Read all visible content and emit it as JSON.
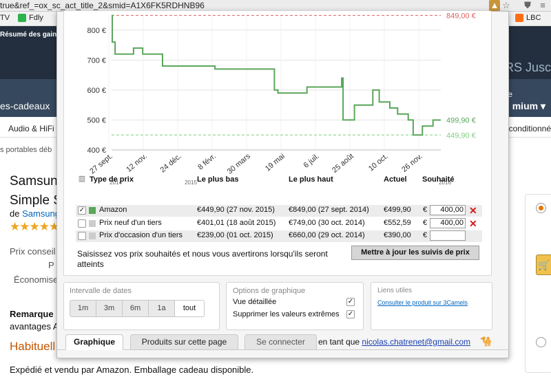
{
  "browser": {
    "url_fragment": "true&ref_=ox_sc_act_title_2&smid=A1X6FK5RDHNB96",
    "bookmarks": [
      "TV",
      "Fdly",
      "LBC"
    ]
  },
  "amazon": {
    "top_text": "Résumé des gains",
    "brand_right": "RS Jusc",
    "nav_left": "es-cadeaux",
    "nav_right": "mium ▾",
    "nav_right_small": "e",
    "category_left": "Audio & HiFi",
    "category_right": "conditionné",
    "breadcrumb": "s portables déb",
    "title_line1": "Samsung",
    "title_line2": "Simple S",
    "by_prefix": "de",
    "by_link": "Samsung",
    "stars": "★★★★★",
    "prix_conseille": "Prix conseil",
    "prix": "P",
    "economisez": "Économise",
    "remarque": "Remarque",
    "avantages": "avantages A",
    "habituel": "Habituell",
    "expedie": "Expédié et vendu par Amazon. Emballage cadeau disponible.",
    "cart_icon": "cart-icon"
  },
  "colors": {
    "amazon_series": "#5aa65a",
    "max_line": "#e06060",
    "min_line": "#7fcf7f",
    "link": "#0066c0"
  },
  "chart_data": {
    "type": "line",
    "ylabels": [
      "800 €",
      "700 €",
      "600 €",
      "500 €",
      "400 €"
    ],
    "ylim": [
      400,
      850
    ],
    "grid": true,
    "xlabels": [
      "27 sept.",
      "12 nov.",
      "24 déc.",
      "8 févr.",
      "30 mars",
      "19 mai",
      "6 juil.",
      "25 août",
      "10 oct.",
      "26 nov."
    ],
    "year_labels": [
      "2014",
      "2015",
      "2016"
    ],
    "reference_lines": [
      {
        "label": "849,00 €",
        "value": 849.0,
        "color": "#e06060"
      },
      {
        "label": "449,90 €",
        "value": 449.9,
        "color": "#7fcf7f"
      }
    ],
    "current_label": {
      "label": "499,90 €",
      "value": 499.9
    },
    "series": [
      {
        "name": "Amazon",
        "points": [
          [
            "2014-09-27",
            849
          ],
          [
            "2014-09-28",
            760
          ],
          [
            "2014-10-02",
            720
          ],
          [
            "2014-10-25",
            720
          ],
          [
            "2014-10-28",
            740
          ],
          [
            "2014-11-10",
            720
          ],
          [
            "2014-12-05",
            720
          ],
          [
            "2014-12-08",
            680
          ],
          [
            "2015-02-10",
            680
          ],
          [
            "2015-02-20",
            670
          ],
          [
            "2015-05-05",
            670
          ],
          [
            "2015-05-15",
            600
          ],
          [
            "2015-05-20",
            590
          ],
          [
            "2015-06-30",
            610
          ],
          [
            "2015-07-20",
            610
          ],
          [
            "2015-08-18",
            640
          ],
          [
            "2015-08-20",
            500
          ],
          [
            "2015-09-05",
            550
          ],
          [
            "2015-10-01",
            600
          ],
          [
            "2015-10-10",
            560
          ],
          [
            "2015-10-25",
            540
          ],
          [
            "2015-11-05",
            520
          ],
          [
            "2015-11-20",
            500
          ],
          [
            "2015-11-27",
            449.9
          ],
          [
            "2015-12-10",
            480
          ],
          [
            "2015-12-25",
            499.9
          ],
          [
            "2016-01-05",
            499.9
          ]
        ]
      }
    ]
  },
  "table": {
    "headers": [
      "Type de prix",
      "Le plus bas",
      "Le plus haut",
      "Actuel",
      "Souhaité"
    ],
    "rows": [
      {
        "checked": true,
        "swatch": "#5aa65a",
        "type": "Amazon",
        "low": "€449,90 (27 nov. 2015)",
        "high": "€849,00 (27 sept. 2014)",
        "current": "€499,90",
        "wish_currency": "€",
        "wish": "400,00",
        "has_delete": true
      },
      {
        "checked": false,
        "swatch": "#cccccc",
        "type": "Prix neuf d'un tiers",
        "low": "€401,01 (18 août 2015)",
        "high": "€749,00 (30 oct. 2014)",
        "current": "€552,59",
        "wish_currency": "€",
        "wish": "400,00",
        "has_delete": true
      },
      {
        "checked": false,
        "swatch": "#cccccc",
        "type": "Prix d'occasion d'un tiers",
        "low": "€239,00 (01 oct. 2015)",
        "high": "€660,00 (29 oct. 2014)",
        "current": "€390,00",
        "wish_currency": "€",
        "wish": "",
        "has_delete": false
      }
    ],
    "note": "Saisissez vos prix souhaités et nous vous avertirons lorsqu'ils seront atteints",
    "update_button": "Mettre à jour les suivis de prix"
  },
  "date_range": {
    "title": "Intervalle de dates",
    "options": [
      "1m",
      "3m",
      "6m",
      "1a",
      "tout"
    ],
    "selected": "tout"
  },
  "graph_options": {
    "title": "Options de graphique",
    "items": [
      {
        "label": "Vue détaillée",
        "checked": true
      },
      {
        "label": "Supprimer les valeurs extrêmes",
        "checked": true
      }
    ]
  },
  "useful_links": {
    "title": "Liens utiles",
    "link": "Consulter le produit sur 3Camels"
  },
  "tabs": {
    "items": [
      "Graphique",
      "Produits sur cette page",
      "Se connecter"
    ],
    "active": "Graphique"
  },
  "login": {
    "prefix": "en tant que",
    "email": "nicolas.chatrenet@gmail.com"
  }
}
